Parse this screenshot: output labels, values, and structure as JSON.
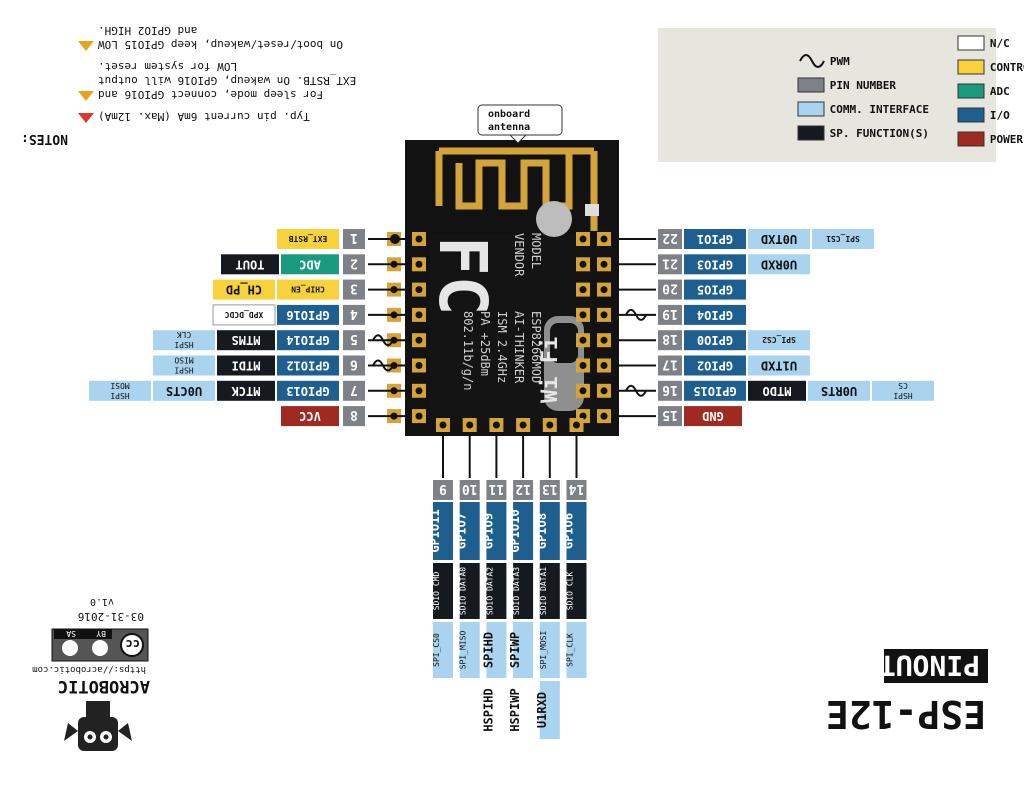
{
  "title": "ESP-12E",
  "subtitle": "PINOUT",
  "colors": {
    "nc": "#ffffff",
    "control": "#f7d23c",
    "adc": "#1a9a7e",
    "io": "#1f5f8f",
    "power": "#9e2a21",
    "pin_number": "#7d8288",
    "comm": "#a9d3ee",
    "sp_function": "#151a20",
    "chip": "#121212",
    "antenna": "#d4a43a"
  },
  "legend": {
    "items": [
      {
        "label": "N/C",
        "key": "nc"
      },
      {
        "label": "CONTROL",
        "key": "control"
      },
      {
        "label": "ADC",
        "key": "adc"
      },
      {
        "label": "I/O",
        "key": "io"
      },
      {
        "label": "POWER",
        "key": "power"
      },
      {
        "label": "PWM",
        "key": "pwm"
      },
      {
        "label": "PIN NUMBER",
        "key": "pin_number"
      },
      {
        "label": "COMM. INTERFACE",
        "key": "comm"
      },
      {
        "label": "SP. FUNCTION(S)",
        "key": "sp_function"
      }
    ]
  },
  "notes": {
    "heading": "NOTES:",
    "items": [
      "Typ. pin current 6mA (Max. 12mA)",
      "For sleep mode, connect GPIO16 and",
      "EXT_RSTB. On wakeup, GPIO16 will output",
      "LOW for system reset.",
      "On boot/reset/wakeup, keep GPIO15 LOW",
      "and GPIO2 HIGH."
    ]
  },
  "antenna_label": [
    "onboard",
    "antenna"
  ],
  "chip": {
    "vendor_logo": "FC",
    "lines": [
      "MODEL",
      "VENDOR",
      "ESP8266MOD",
      "AI-THINKER",
      "ISM 2.4GHz",
      "PA +25dBm",
      "802.11b/g/n"
    ],
    "wifi_logo": "Wi Fi"
  },
  "credits": {
    "brand": "ACROBOTIC",
    "url": "https://acrobotic.com",
    "license": [
      "cc",
      "BY",
      "SA"
    ],
    "date": "03-31-2016",
    "version": "v1.0"
  },
  "pins_left": [
    {
      "num": "1",
      "labels": [
        {
          "t": "EXT_RSTB",
          "c": "control",
          "s": "sm"
        }
      ]
    },
    {
      "num": "2",
      "labels": [
        {
          "t": "ADC",
          "c": "adc"
        },
        {
          "t": "TOUT",
          "c": "sp_function"
        }
      ]
    },
    {
      "num": "3",
      "labels": [
        {
          "t": "CHIP_EN",
          "c": "control",
          "s": "sm"
        },
        {
          "t": "CH_PD",
          "c": "control"
        }
      ]
    },
    {
      "num": "4",
      "labels": [
        {
          "t": "GPIO16",
          "c": "io"
        },
        {
          "t": "XPD_DCDC",
          "c": "nc",
          "s": "sm"
        }
      ]
    },
    {
      "num": "5",
      "pwm": true,
      "labels": [
        {
          "t": "GPIO14",
          "c": "io"
        },
        {
          "t": "MTMS",
          "c": "sp_function"
        },
        {
          "t": "HSPI CLK",
          "c": "comm",
          "s": "sm"
        }
      ]
    },
    {
      "num": "6",
      "pwm": true,
      "labels": [
        {
          "t": "GPIO12",
          "c": "io"
        },
        {
          "t": "MTDI",
          "c": "sp_function"
        },
        {
          "t": "HSPI MISO",
          "c": "comm",
          "s": "sm"
        }
      ]
    },
    {
      "num": "7",
      "labels": [
        {
          "t": "GPIO13",
          "c": "io"
        },
        {
          "t": "MTCK",
          "c": "sp_function"
        },
        {
          "t": "U0CTS",
          "c": "comm"
        },
        {
          "t": "HSPI MOSI",
          "c": "comm",
          "s": "sm"
        }
      ]
    },
    {
      "num": "8",
      "labels": [
        {
          "t": "VCC",
          "c": "power"
        }
      ]
    }
  ],
  "pins_right": [
    {
      "num": "22",
      "labels": [
        {
          "t": "GPIO1",
          "c": "io"
        },
        {
          "t": "U0TXD",
          "c": "comm"
        },
        {
          "t": "SPI_CS1",
          "c": "comm",
          "s": "sm"
        }
      ]
    },
    {
      "num": "21",
      "labels": [
        {
          "t": "GPIO3",
          "c": "io"
        },
        {
          "t": "U0RXD",
          "c": "comm"
        }
      ]
    },
    {
      "num": "20",
      "labels": [
        {
          "t": "GPIO5",
          "c": "io"
        }
      ]
    },
    {
      "num": "19",
      "pwm": true,
      "labels": [
        {
          "t": "GPIO4",
          "c": "io"
        }
      ]
    },
    {
      "num": "18",
      "labels": [
        {
          "t": "GPIO0",
          "c": "io"
        },
        {
          "t": "SPI_CS2",
          "c": "comm",
          "s": "sm"
        }
      ]
    },
    {
      "num": "17",
      "labels": [
        {
          "t": "GPIO2",
          "c": "io"
        },
        {
          "t": "U1TXD",
          "c": "comm"
        }
      ]
    },
    {
      "num": "16",
      "pwm": true,
      "labels": [
        {
          "t": "GPIO15",
          "c": "io"
        },
        {
          "t": "MTDO",
          "c": "sp_function"
        },
        {
          "t": "U0RTS",
          "c": "comm"
        },
        {
          "t": "HSPI CS",
          "c": "comm",
          "s": "sm"
        }
      ]
    },
    {
      "num": "15",
      "labels": [
        {
          "t": "GND",
          "c": "power"
        }
      ]
    }
  ],
  "pins_bottom": [
    {
      "num": "9",
      "labels": [
        {
          "t": "GPIO11",
          "c": "io"
        },
        {
          "t": "SDIO CMD",
          "c": "sp_function",
          "s": "sm"
        },
        {
          "t": "SPI_CS0",
          "c": "comm",
          "s": "sm"
        }
      ]
    },
    {
      "num": "10",
      "labels": [
        {
          "t": "GPIO7",
          "c": "io"
        },
        {
          "t": "SDIO DATA0",
          "c": "sp_function",
          "s": "sm"
        },
        {
          "t": "SPI_MISO",
          "c": "comm",
          "s": "sm"
        }
      ]
    },
    {
      "num": "11",
      "labels": [
        {
          "t": "GPIO9",
          "c": "io"
        },
        {
          "t": "SDIO DATA2",
          "c": "sp_function",
          "s": "sm"
        },
        {
          "t": "SPIHD",
          "c": "comm"
        },
        {
          "t": "HSPIHD",
          "c": "nc"
        }
      ]
    },
    {
      "num": "12",
      "labels": [
        {
          "t": "GPIO10",
          "c": "io"
        },
        {
          "t": "SDIO DATA3",
          "c": "sp_function",
          "s": "sm"
        },
        {
          "t": "SPIWP",
          "c": "comm"
        },
        {
          "t": "HSPIWP",
          "c": "nc"
        }
      ]
    },
    {
      "num": "13",
      "labels": [
        {
          "t": "GPIO8",
          "c": "io"
        },
        {
          "t": "SDIO DATA1",
          "c": "sp_function",
          "s": "sm"
        },
        {
          "t": "SPI_MOSI",
          "c": "comm",
          "s": "sm"
        },
        {
          "t": "U1RXD",
          "c": "comm"
        }
      ]
    },
    {
      "num": "14",
      "labels": [
        {
          "t": "GPIO6",
          "c": "io"
        },
        {
          "t": "SDIO CLK",
          "c": "sp_function",
          "s": "sm"
        },
        {
          "t": "SPI_CLK",
          "c": "comm",
          "s": "sm"
        }
      ]
    }
  ]
}
